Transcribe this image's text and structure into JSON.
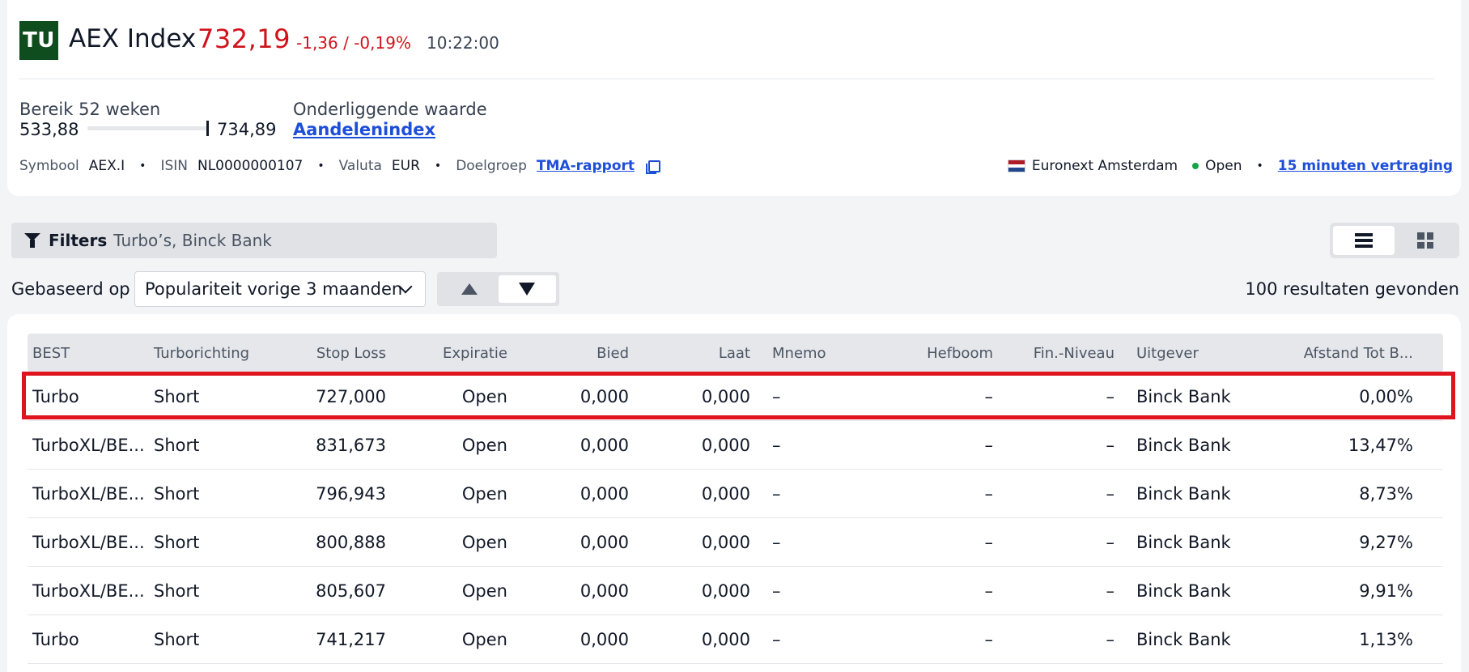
{
  "header": {
    "logo_text": "TU",
    "title": "AEX Index",
    "price": "732,19",
    "change": "-1,36 / -0,19%",
    "time": "10:22:00",
    "range_label": "Bereik 52 weken",
    "range_low": "533,88",
    "range_high": "734,89",
    "range_position": 0.99,
    "underlying_label": "Onderliggende waarde",
    "underlying_link": "Aandelenindex",
    "meta": {
      "symbol_key": "Symbool",
      "symbol_val": "AEX.I",
      "isin_key": "ISIN",
      "isin_val": "NL0000000107",
      "currency_key": "Valuta",
      "currency_val": "EUR",
      "target_key": "Doelgroep",
      "target_link": "TMA-rapport",
      "separator": "•"
    },
    "exchange": {
      "name": "Euronext Amsterdam",
      "status": "Open",
      "separator": "•",
      "delay_link": "15 minuten vertraging"
    }
  },
  "filters": {
    "title": "Filters",
    "value": "Turbo’s, Binck Bank"
  },
  "sort": {
    "label": "Gebaseerd op",
    "selected": "Populariteit vorige 3 maanden",
    "results": "100 resultaten gevonden"
  },
  "table": {
    "columns": [
      "BEST",
      "Turborichting",
      "Stop Loss",
      "Expiratie",
      "Bied",
      "Laat",
      "Mnemo",
      "Hefboom",
      "Fin.-Niveau",
      "Uitgever",
      "Afstand Tot B..."
    ],
    "rows": [
      [
        "Turbo",
        "Short",
        "727,000",
        "Open",
        "0,000",
        "0,000",
        "–",
        "–",
        "–",
        "Binck Bank",
        "0,00%"
      ],
      [
        "TurboXL/BE...",
        "Short",
        "831,673",
        "Open",
        "0,000",
        "0,000",
        "–",
        "–",
        "–",
        "Binck Bank",
        "13,47%"
      ],
      [
        "TurboXL/BE...",
        "Short",
        "796,943",
        "Open",
        "0,000",
        "0,000",
        "–",
        "–",
        "–",
        "Binck Bank",
        "8,73%"
      ],
      [
        "TurboXL/BE...",
        "Short",
        "800,888",
        "Open",
        "0,000",
        "0,000",
        "–",
        "–",
        "–",
        "Binck Bank",
        "9,27%"
      ],
      [
        "TurboXL/BE...",
        "Short",
        "805,607",
        "Open",
        "0,000",
        "0,000",
        "–",
        "–",
        "–",
        "Binck Bank",
        "9,91%"
      ],
      [
        "Turbo",
        "Short",
        "741,217",
        "Open",
        "0,000",
        "0,000",
        "–",
        "–",
        "–",
        "Binck Bank",
        "1,13%"
      ]
    ]
  },
  "colors": {
    "accent_negative": "#d0121b",
    "link": "#1d4ed8",
    "logo_bg": "#0f4d1f",
    "highlight": "#e0141e"
  }
}
